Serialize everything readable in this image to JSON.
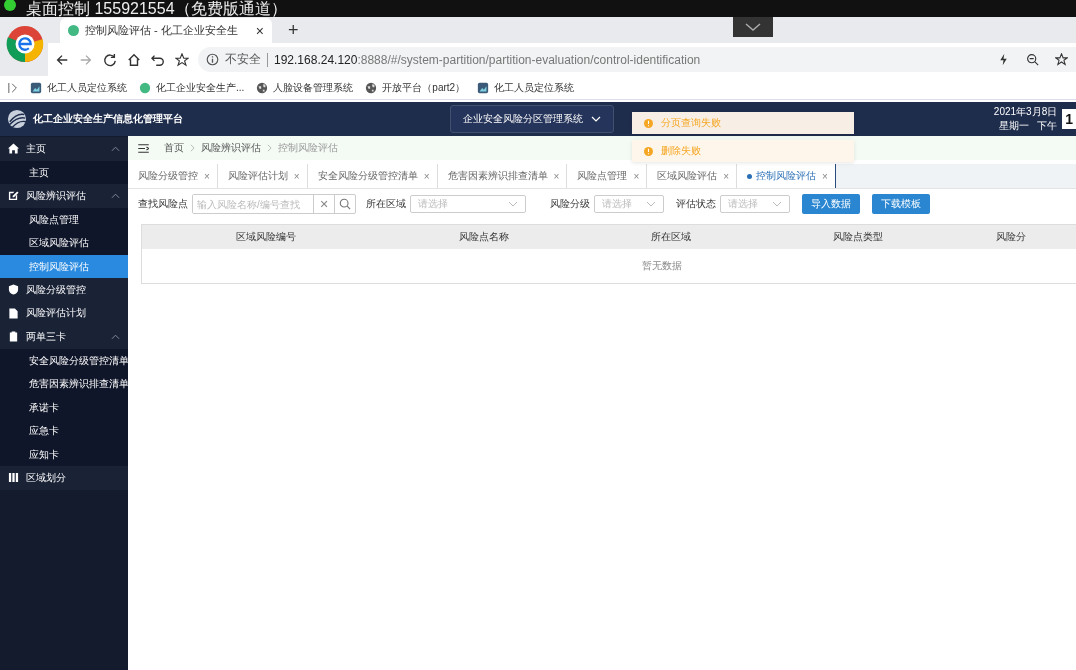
{
  "os_bar": {
    "title": "桌面控制 155921554（免费版通道）"
  },
  "browser": {
    "tab": {
      "title": "控制风险评估 - 化工企业安全生",
      "close": "×"
    },
    "new_tab": "+",
    "security": "不安全",
    "url_host": "192.168.24.120",
    "url_path": ":8888/#/system-partition/partition-evaluation/control-identification",
    "bookmarks": [
      {
        "label": "化工人员定位系统",
        "kind": "app"
      },
      {
        "label": "化工企业安全生产...",
        "kind": "vue"
      },
      {
        "label": "人脸设备管理系统",
        "kind": "globe"
      },
      {
        "label": "开放平台（part2）",
        "kind": "globe"
      },
      {
        "label": "化工人员定位系统",
        "kind": "app"
      }
    ]
  },
  "header": {
    "title": "化工企业安全生产信息化管理平台",
    "system": "企业安全风险分区管理系统",
    "date": "2021年3月8日",
    "weekday": "星期一",
    "period": "下午",
    "time": "1"
  },
  "sidebar": {
    "items": [
      {
        "label": "主页",
        "expanded": true,
        "children": [
          {
            "label": "主页",
            "selected": false
          }
        ]
      },
      {
        "label": "风险辨识评估",
        "expanded": true,
        "children": [
          {
            "label": "风险点管理",
            "selected": false
          },
          {
            "label": "区域风险评估",
            "selected": false
          },
          {
            "label": "控制风险评估",
            "selected": true
          }
        ]
      },
      {
        "label": "风险分级管控"
      },
      {
        "label": "风险评估计划"
      },
      {
        "label": "两单三卡",
        "expanded": true,
        "children": [
          {
            "label": "安全风险分级管控清单",
            "selected": false
          },
          {
            "label": "危害因素辨识排查清单",
            "selected": false
          },
          {
            "label": "承诺卡",
            "selected": false
          },
          {
            "label": "应急卡",
            "selected": false
          },
          {
            "label": "应知卡",
            "selected": false
          }
        ]
      },
      {
        "label": "区域划分"
      }
    ]
  },
  "breadcrumb": [
    "首页",
    "风险辨识评估",
    "控制风险评估"
  ],
  "tabs": [
    {
      "label": "风险分级管控",
      "selected": false
    },
    {
      "label": "风险评估计划",
      "selected": false
    },
    {
      "label": "安全风险分级管控清单",
      "selected": false
    },
    {
      "label": "危害因素辨识排查清单",
      "selected": false
    },
    {
      "label": "风险点管理",
      "selected": false
    },
    {
      "label": "区域风险评估",
      "selected": false
    },
    {
      "label": "控制风险评估",
      "selected": true
    }
  ],
  "tab_close": "×",
  "toasts": [
    "分页查询失败",
    "删除失败"
  ],
  "filters": {
    "search_label": "查找风险点",
    "search_placeholder": "输入风险名称/编号查找",
    "clear": "✕",
    "selects": [
      {
        "label": "所在区域",
        "placeholder": "请选择"
      },
      {
        "label": "风险分级",
        "placeholder": "请选择"
      },
      {
        "label": "评估状态",
        "placeholder": "请选择"
      }
    ],
    "buttons": [
      "导入数据",
      "下载模板"
    ]
  },
  "table": {
    "columns": [
      "区域风险编号",
      "风险点名称",
      "所在区域",
      "风险点类型",
      "风险分"
    ],
    "empty": "暂无数据"
  }
}
